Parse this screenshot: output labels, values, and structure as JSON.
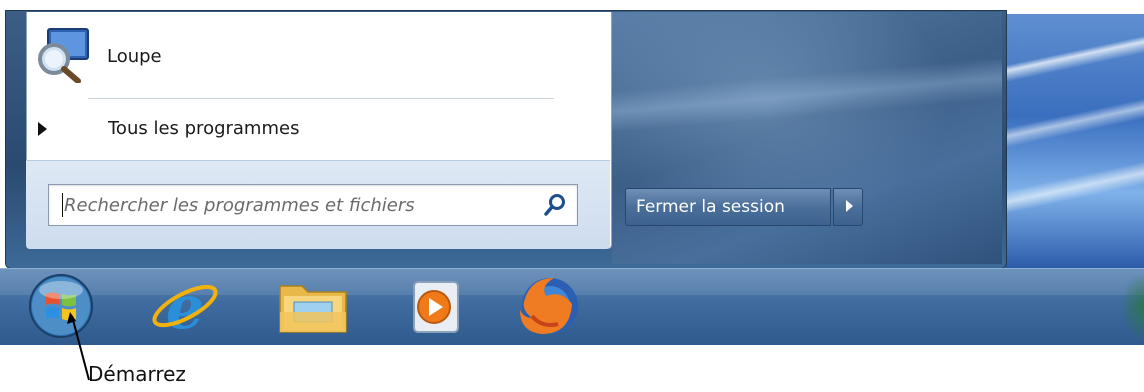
{
  "start_menu": {
    "pinned_item": {
      "label": "Loupe",
      "icon": "magnifier-icon"
    },
    "all_programs": {
      "label": "Tous les programmes",
      "icon": "arrow-right-icon"
    },
    "search": {
      "placeholder": "Rechercher les programmes et fichiers",
      "icon": "search-icon"
    },
    "shutdown": {
      "label": "Fermer la session",
      "menu_icon": "arrow-right-icon"
    }
  },
  "taskbar": {
    "items": [
      {
        "name": "start-orb",
        "icon": "windows-logo-icon"
      },
      {
        "name": "internet-explorer",
        "icon": "ie-icon"
      },
      {
        "name": "windows-explorer",
        "icon": "folder-icon"
      },
      {
        "name": "windows-media-player",
        "icon": "play-icon"
      },
      {
        "name": "firefox",
        "icon": "firefox-icon"
      }
    ]
  },
  "annotation": {
    "label": "Démarrez"
  },
  "colors": {
    "taskbar": "#3f6b9f",
    "menu_frame": "#2a4a70",
    "left_pane": "#ffffff",
    "shutdown_button": "#4a6f99"
  }
}
